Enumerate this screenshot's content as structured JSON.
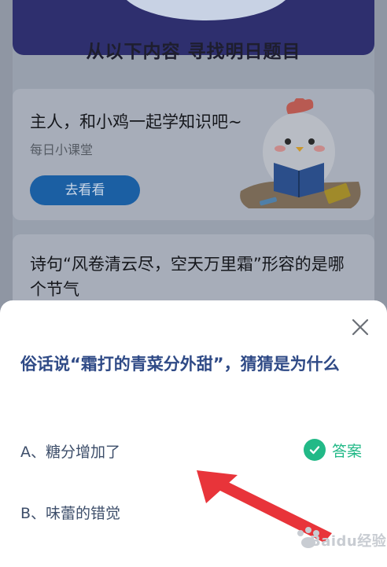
{
  "background": {
    "section_title": "从以下内容 寻找明日题目",
    "card1": {
      "title": "主人，和小鸡一起学知识吧~",
      "subtitle": "每日小课堂",
      "button_label": "去看看"
    },
    "card2": {
      "title": "诗句“风卷清云尽，空天万里霜”形容的是哪个节气"
    }
  },
  "sheet": {
    "question": "俗话说“霜打的青菜分外甜”，猜猜是为什么",
    "options": [
      {
        "label": "A、糖分增加了",
        "is_answer": true
      },
      {
        "label": "B、味蕾的错觉",
        "is_answer": false
      }
    ],
    "answer_label": "答案",
    "close_icon": "close-icon"
  },
  "watermark": {
    "text": "Baidu经验"
  },
  "colors": {
    "question_text": "#2f4a86",
    "answer_green": "#22b987",
    "button_blue": "#1b5fa3",
    "arrow_red": "#e8343a"
  }
}
